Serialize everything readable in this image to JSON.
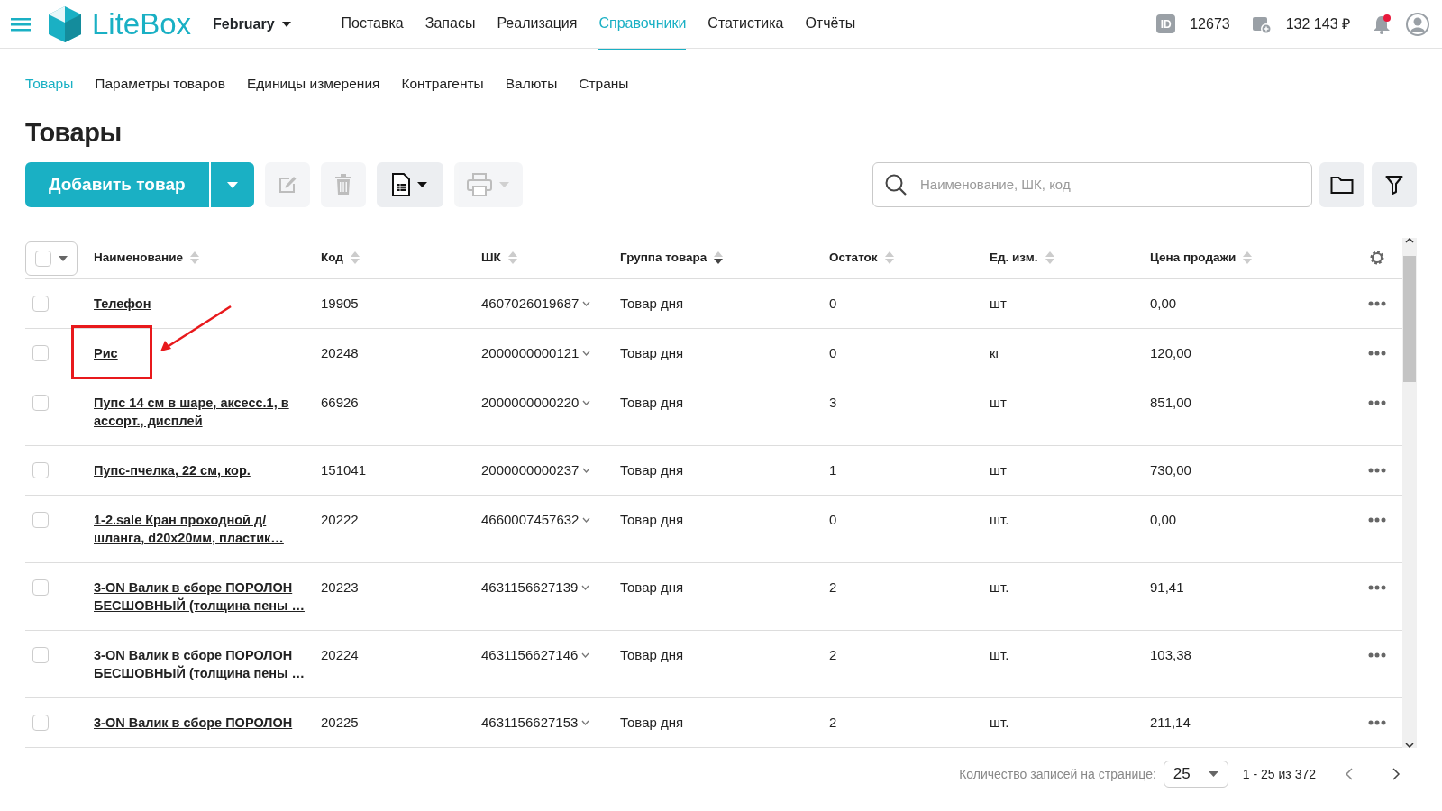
{
  "topbar": {
    "logo": "LiteBox",
    "period": "February",
    "menu": [
      {
        "label": "Поставка",
        "selected": false
      },
      {
        "label": "Запасы",
        "selected": false
      },
      {
        "label": "Реализация",
        "selected": false
      },
      {
        "label": "Справочники",
        "selected": true
      },
      {
        "label": "Статистика",
        "selected": false
      },
      {
        "label": "Отчёты",
        "selected": false
      }
    ],
    "id_label": "ID",
    "account_id": "12673",
    "balance": "132 143 ₽",
    "has_notification": true
  },
  "subnav": [
    {
      "label": "Товары",
      "selected": true
    },
    {
      "label": "Параметры товаров",
      "selected": false
    },
    {
      "label": "Единицы измерения",
      "selected": false
    },
    {
      "label": "Контрагенты",
      "selected": false
    },
    {
      "label": "Валюты",
      "selected": false
    },
    {
      "label": "Страны",
      "selected": false
    }
  ],
  "page_title": "Товары",
  "toolbar": {
    "add_button": "Добавить товар",
    "edit_disabled": true,
    "delete_disabled": true,
    "print_disabled": true,
    "search": {
      "placeholder": "Наименование, ШК, код"
    }
  },
  "table": {
    "select_all_checked": false,
    "columns": [
      {
        "label": "Наименование",
        "sorted": false
      },
      {
        "label": "Код",
        "sorted": false
      },
      {
        "label": "ШК",
        "sorted": false
      },
      {
        "label": "Группа товара",
        "sorted": true
      },
      {
        "label": "Остаток",
        "sorted": false
      },
      {
        "label": "Ед. изм.",
        "sorted": false
      },
      {
        "label": "Цена продажи",
        "sorted": false
      }
    ],
    "rows": [
      {
        "checked": false,
        "highlighted": false,
        "name": "Телефон",
        "code": "19905",
        "barcode": "4607026019687",
        "group": "Товар дня",
        "stock": "0",
        "unit": "шт",
        "price": "0,00"
      },
      {
        "checked": false,
        "highlighted": true,
        "name": "Рис",
        "code": "20248",
        "barcode": "2000000000121",
        "group": "Товар дня",
        "stock": "0",
        "unit": "кг",
        "price": "120,00"
      },
      {
        "checked": false,
        "highlighted": false,
        "name": "Пупс 14 см в шаре, аксесс.1, в ассорт., дисплей",
        "code": "66926",
        "barcode": "2000000000220",
        "group": "Товар дня",
        "stock": "3",
        "unit": "шт",
        "price": "851,00"
      },
      {
        "checked": false,
        "highlighted": false,
        "name": "Пупс-пчелка, 22 см, кор.",
        "code": "151041",
        "barcode": "2000000000237",
        "group": "Товар дня",
        "stock": "1",
        "unit": "шт",
        "price": "730,00"
      },
      {
        "checked": false,
        "highlighted": false,
        "name": "1-2.sale Кран проходной д/шланга, d20x20мм, пластик…",
        "code": "20222",
        "barcode": "4660007457632",
        "group": "Товар дня",
        "stock": "0",
        "unit": "шт.",
        "price": "0,00"
      },
      {
        "checked": false,
        "highlighted": false,
        "name": "3-ON Валик в сборе ПОРОЛОН БЕСШОВНЫЙ (толщина пены …",
        "code": "20223",
        "barcode": "4631156627139",
        "group": "Товар дня",
        "stock": "2",
        "unit": "шт.",
        "price": "91,41"
      },
      {
        "checked": false,
        "highlighted": false,
        "name": "3-ON Валик в сборе ПОРОЛОН БЕСШОВНЫЙ (толщина пены …",
        "code": "20224",
        "barcode": "4631156627146",
        "group": "Товар дня",
        "stock": "2",
        "unit": "шт.",
        "price": "103,38"
      },
      {
        "checked": false,
        "highlighted": false,
        "name": "3-ON Валик в сборе ПОРОЛОН",
        "code": "20225",
        "barcode": "4631156627153",
        "group": "Товар дня",
        "stock": "2",
        "unit": "шт.",
        "price": "211,14"
      }
    ]
  },
  "pagination": {
    "label": "Количество записей на странице:",
    "page_size": "25",
    "range": "1 - 25 из 372"
  }
}
